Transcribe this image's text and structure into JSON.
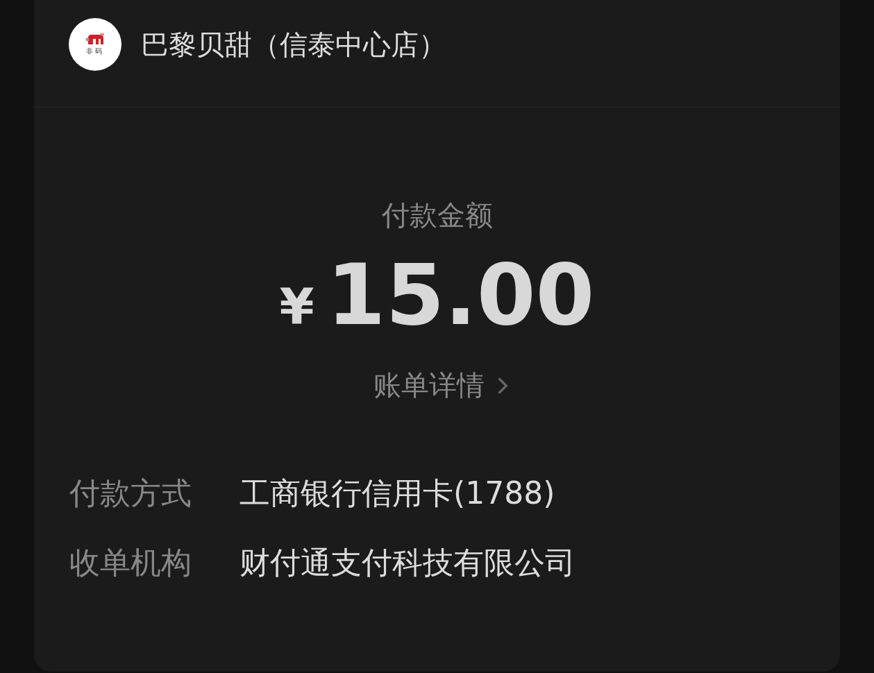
{
  "merchant": {
    "logo_text": "非码",
    "name": "巴黎贝甜（信泰中心店）"
  },
  "amount": {
    "label": "付款金额",
    "currency": "¥",
    "value": "15.00"
  },
  "details_link": {
    "label": "账单详情"
  },
  "info_rows": [
    {
      "label": "付款方式",
      "value": "工商银行信用卡(1788)"
    },
    {
      "label": "收单机构",
      "value": "财付通支付科技有限公司"
    }
  ]
}
